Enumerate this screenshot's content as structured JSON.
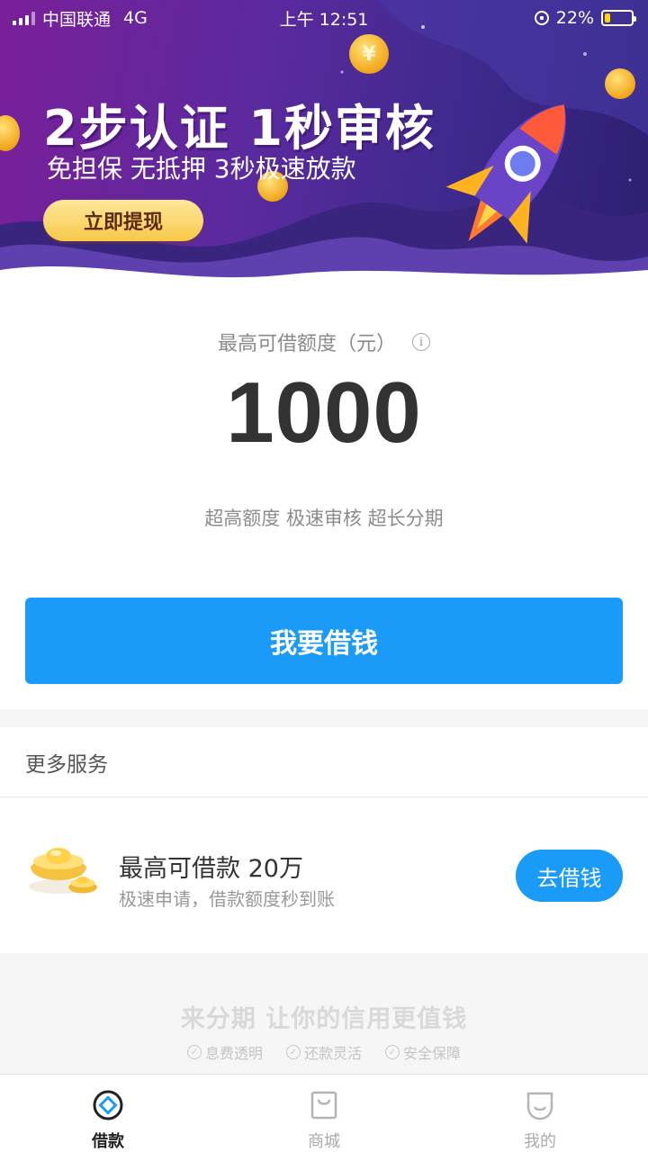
{
  "status_bar": {
    "carrier": "中国联通",
    "network": "4G",
    "time": "上午 12:51",
    "battery": "22%",
    "battery_level": 0.22
  },
  "banner": {
    "title": "2步认证 1秒审核",
    "subtitle": "免担保 无抵押 3秒极速放款",
    "button_label": "立即提现",
    "coin_symbol": "¥"
  },
  "loan": {
    "limit_label": "最高可借额度（元）",
    "info_icon": "i",
    "amount": "1000",
    "tagline": "超高额度 极速审核 超长分期",
    "borrow_button": "我要借钱"
  },
  "services": {
    "header": "更多服务",
    "items": [
      {
        "title": "最高可借款 20万",
        "description": "极速申请，借款额度秒到账",
        "button": "去借钱",
        "icon": "gold-ingot-icon"
      }
    ]
  },
  "slogan": {
    "title": "来分期 让你的信用更值钱",
    "badges": [
      "息费透明",
      "还款灵活",
      "安全保障"
    ]
  },
  "tab_bar": {
    "tabs": [
      {
        "label": "借款",
        "icon": "loan-icon",
        "active": true
      },
      {
        "label": "商城",
        "icon": "shop-icon",
        "active": false
      },
      {
        "label": "我的",
        "icon": "profile-icon",
        "active": false
      }
    ]
  },
  "colors": {
    "accent": "#1a9bf7",
    "banner_purple": "#6a2599",
    "coin_gold": "#f2a619"
  }
}
